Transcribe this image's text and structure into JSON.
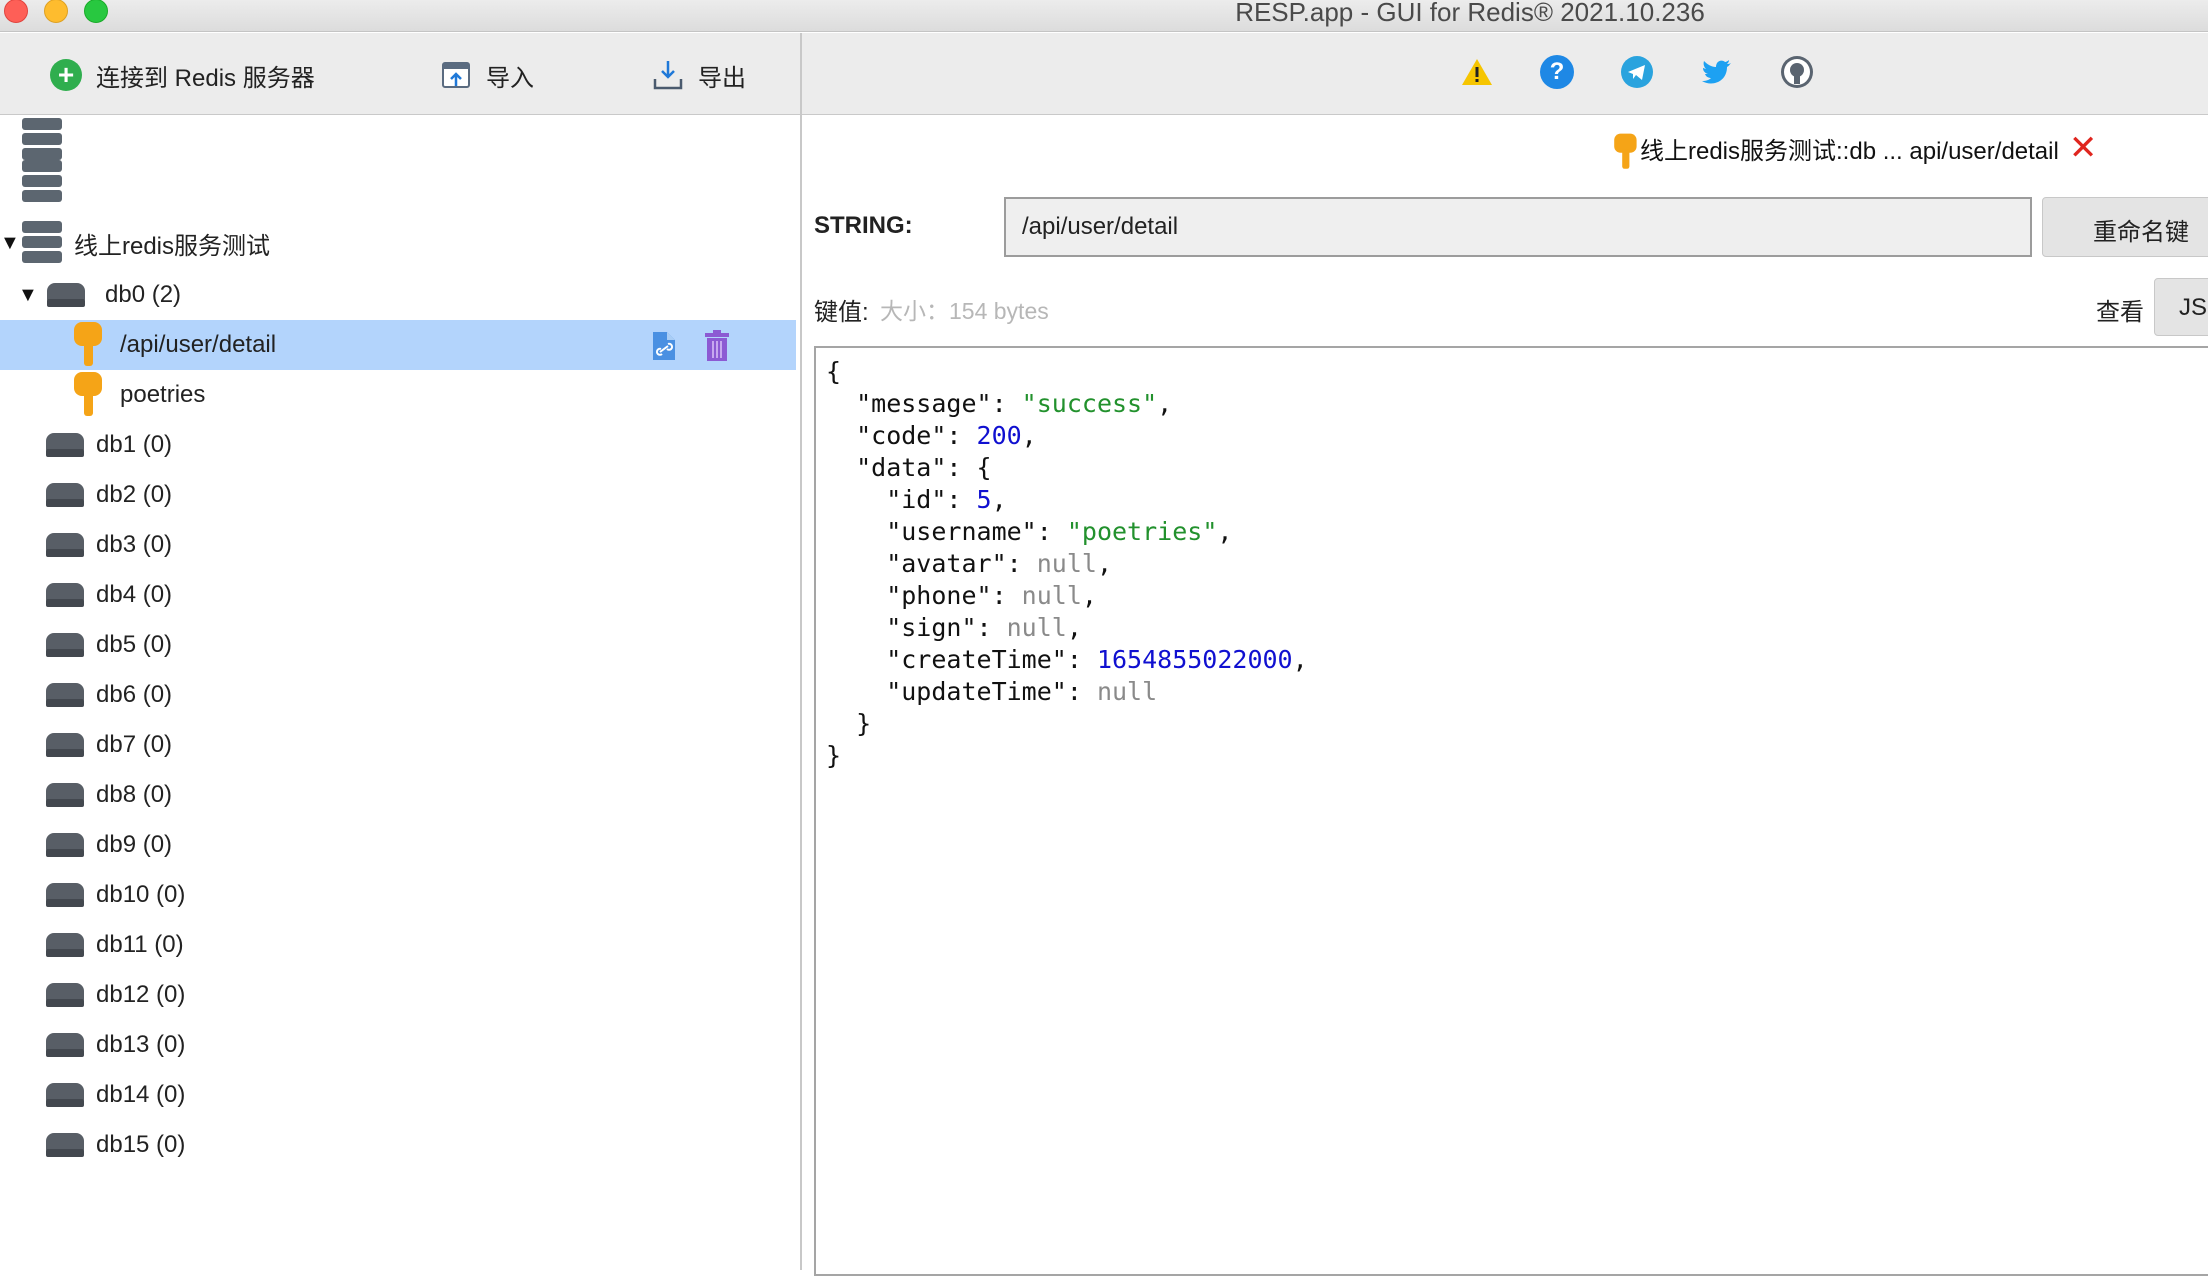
{
  "window": {
    "title": "RESP.app - GUI for Redis® 2021.10.236"
  },
  "toolbar": {
    "connect_label": "连接到 Redis 服务器",
    "import_label": "导入",
    "export_label": "导出"
  },
  "tree": {
    "server_name": "线上redis服务测试",
    "db0_label": "db0  (2)",
    "keys": [
      "/api/user/detail",
      "poetries"
    ],
    "dbs": [
      "db1  (0)",
      "db2  (0)",
      "db3  (0)",
      "db4  (0)",
      "db5  (0)",
      "db6  (0)",
      "db7  (0)",
      "db8  (0)",
      "db9  (0)",
      "db10  (0)",
      "db11  (0)",
      "db12  (0)",
      "db13  (0)",
      "db14  (0)",
      "db15  (0)"
    ]
  },
  "tab": {
    "title": "线上redis服务测试::db ... api/user/detail"
  },
  "key_editor": {
    "type_label": "STRING:",
    "key_name": "/api/user/detail",
    "rename_label": "重命名键",
    "value_label": "键值:",
    "size_label": "大小：154 bytes",
    "view_label": "查看",
    "format_label": "JSO"
  },
  "value_json": {
    "message": "success",
    "code": "200",
    "id": "5",
    "username": "poetries",
    "avatar": "null",
    "phone": "null",
    "sign": "null",
    "createTime": "1654855022000",
    "updateTime": "null"
  },
  "colors": {
    "selection": "#b3d4fc",
    "key_icon": "#f5a417",
    "json_string": "#22912d",
    "json_number": "#1010d0"
  }
}
